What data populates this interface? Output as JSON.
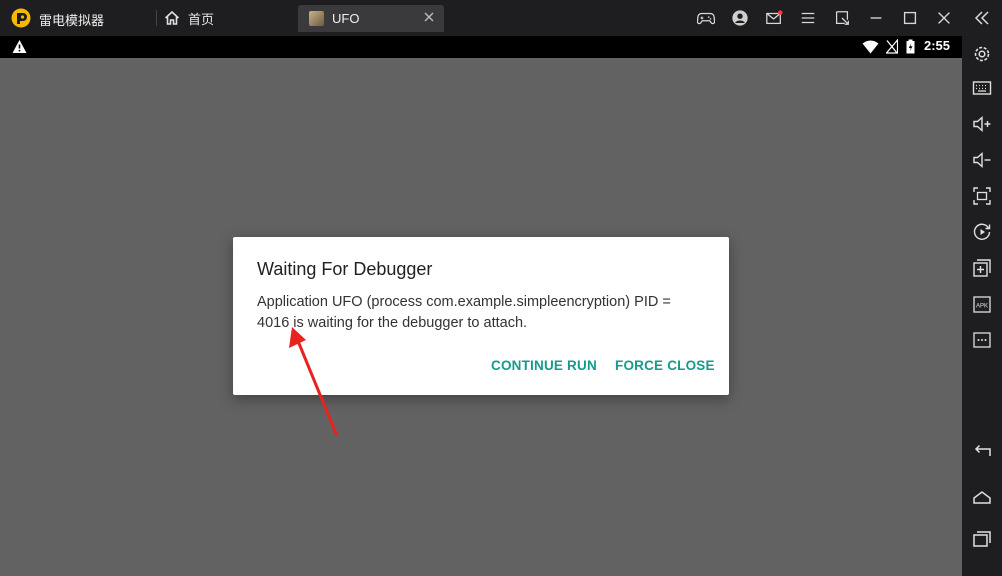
{
  "titlebar": {
    "app_name": "雷电模拟器",
    "home_label": "首页",
    "tab_label": "UFO",
    "icons": [
      "gamepad-icon",
      "account-icon",
      "mail-icon",
      "menu-icon",
      "screen-icon",
      "minimize-icon",
      "maximize-icon",
      "close-icon",
      "collapse-icon"
    ]
  },
  "statusbar": {
    "time": "2:55"
  },
  "dialog": {
    "title": "Waiting For Debugger",
    "message": "Application UFO (process com.example.simpleencryption) PID = 4016 is waiting for the debugger to attach.",
    "continue_label": "CONTINUE RUN",
    "force_close_label": "FORCE CLOSE"
  },
  "sidebar": {
    "items": [
      "settings-icon",
      "keyboard-icon",
      "volume-up-icon",
      "volume-down-icon",
      "fullscreen-icon",
      "record-icon",
      "add-app-icon",
      "apk-icon",
      "more-icon",
      "back-icon",
      "home-icon",
      "recents-icon"
    ],
    "apk_text": "APK"
  },
  "colors": {
    "accent": "#159b8b",
    "arrow": "#e8231f",
    "logo": "#f6b800"
  }
}
